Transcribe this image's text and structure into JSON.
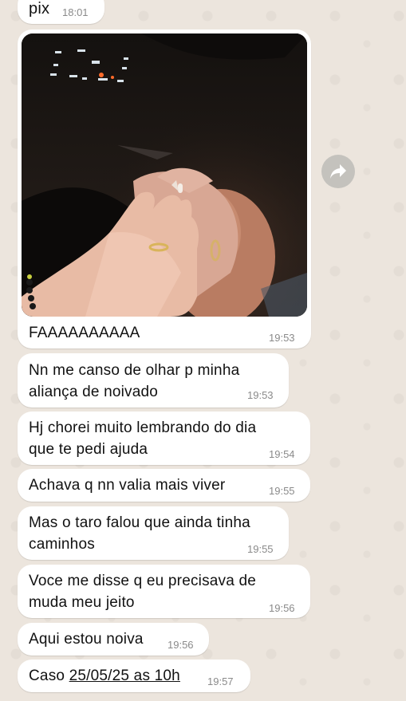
{
  "messages": [
    {
      "text": "pix",
      "time": "18:01"
    },
    {
      "caption": "FAAAAAAAAAA",
      "time": "19:53",
      "image": "hands-with-engagement-rings-photo"
    },
    {
      "text": "Nn me canso de olhar p minha",
      "text2": "aliança de noivado",
      "time": "19:53"
    },
    {
      "text": "Hj chorei muito lembrando do dia",
      "text2": "que te pedi ajuda",
      "time": "19:54"
    },
    {
      "text": "Achava q nn valia mais viver",
      "time": "19:55"
    },
    {
      "text": "Mas o taro falou que ainda tinha",
      "text2": "caminhos",
      "time": "19:55"
    },
    {
      "text": "Voce me disse q eu precisava de",
      "text2": "muda meu jeito",
      "time": "19:56"
    },
    {
      "text": "Aqui estou noiva",
      "time": "19:56"
    },
    {
      "text_prefix": "Caso ",
      "date_link": "25/05/25 as 10h",
      "time": "19:57"
    }
  ],
  "icons": {
    "forward": "forward-arrow-icon"
  },
  "colors": {
    "background": "#ece5dd",
    "bubble": "#ffffff",
    "timestamp": "#8a8a8a",
    "forward_button": "#c4c2bd"
  }
}
